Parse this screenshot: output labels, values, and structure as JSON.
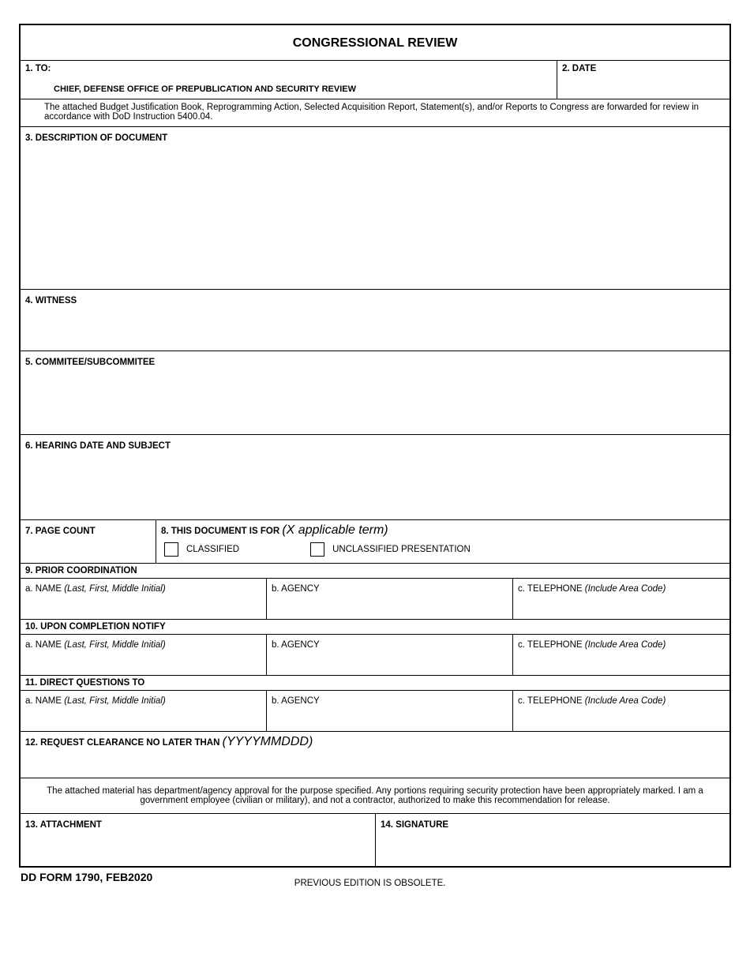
{
  "title": "CONGRESSIONAL REVIEW",
  "field1": {
    "label": "1. TO:",
    "sub": "CHIEF, DEFENSE OFFICE OF PREPUBLICATION AND SECURITY REVIEW"
  },
  "field2": {
    "label": "2. DATE"
  },
  "intro": "The attached Budget Justification Book, Reprogramming Action, Selected Acquisition Report, Statement(s), and/or Reports to Congress are forwarded for review in accordance with DoD Instruction 5400.04.",
  "field3": {
    "label": "3. DESCRIPTION OF DOCUMENT"
  },
  "field4": {
    "label": "4. WITNESS"
  },
  "field5": {
    "label": "5. COMMITEE/SUBCOMMITEE"
  },
  "field6": {
    "label": "6. HEARING DATE AND SUBJECT"
  },
  "field7": {
    "label": "7. PAGE COUNT"
  },
  "field8": {
    "label": "8. THIS DOCUMENT IS FOR ",
    "hint": "(X applicable term)",
    "opt1": "CLASSIFIED",
    "opt2": "UNCLASSIFIED PRESENTATION"
  },
  "field9": {
    "label": "9. PRIOR COORDINATION"
  },
  "field10": {
    "label": "10. UPON COMPLETION NOTIFY"
  },
  "field11": {
    "label": "11. DIRECT QUESTIONS TO"
  },
  "field12": {
    "label": "12. REQUEST CLEARANCE NO LATER THAN ",
    "hint": "(YYYYMMDDD)"
  },
  "cert": "The attached material has department/agency approval for the purpose specified. Any portions requiring security protection have been appropriately marked. I am a government employee (civilian or military), and not a contractor, authorized to make this recommendation for release.",
  "field13": {
    "label": "13. ATTACHMENT"
  },
  "field14": {
    "label": "14. SIGNATURE"
  },
  "sub_a": {
    "label": "a. NAME ",
    "hint": "(Last, First, Middle Initial)"
  },
  "sub_b": {
    "label": "b. AGENCY"
  },
  "sub_c": {
    "label": "c. TELEPHONE ",
    "hint": "(Include Area Code)"
  },
  "footer": {
    "form": "DD FORM 1790, FEB2020",
    "obsolete": "PREVIOUS EDITION IS OBSOLETE."
  }
}
